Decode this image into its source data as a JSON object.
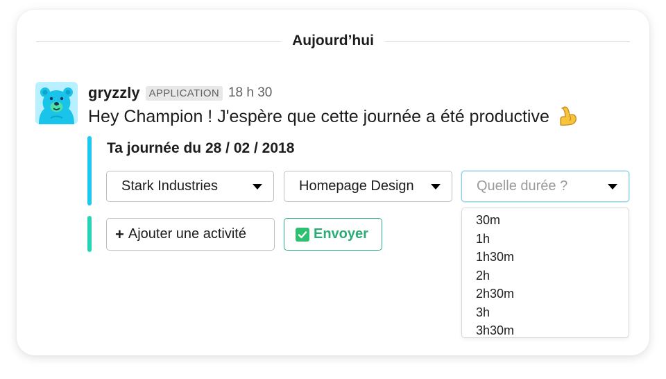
{
  "divider": {
    "label": "Aujourd’hui"
  },
  "message": {
    "username": "gryzzly",
    "badge": "APPLICATION",
    "time": "18 h 30",
    "text": "Hey Champion ! J'espère que cette journée a été productive",
    "emoji_icon": "flexed-biceps-icon"
  },
  "attachment": {
    "title": "Ta journée du 28 / 02 / 2018",
    "selects": [
      {
        "value": "Stark Industries"
      },
      {
        "value": "Homepage Design"
      },
      {
        "placeholder": "Quelle durée ?"
      }
    ],
    "add_button": "Ajouter une activité",
    "send_button": "Envoyer"
  },
  "duration_options": [
    "30m",
    "1h",
    "1h30m",
    "2h",
    "2h30m",
    "3h",
    "3h30m"
  ],
  "colors": {
    "bar_top": "#1ec8ec",
    "bar_bottom": "#26d3b5",
    "send_green": "#2bac76",
    "focus_border": "#8fcde4"
  }
}
